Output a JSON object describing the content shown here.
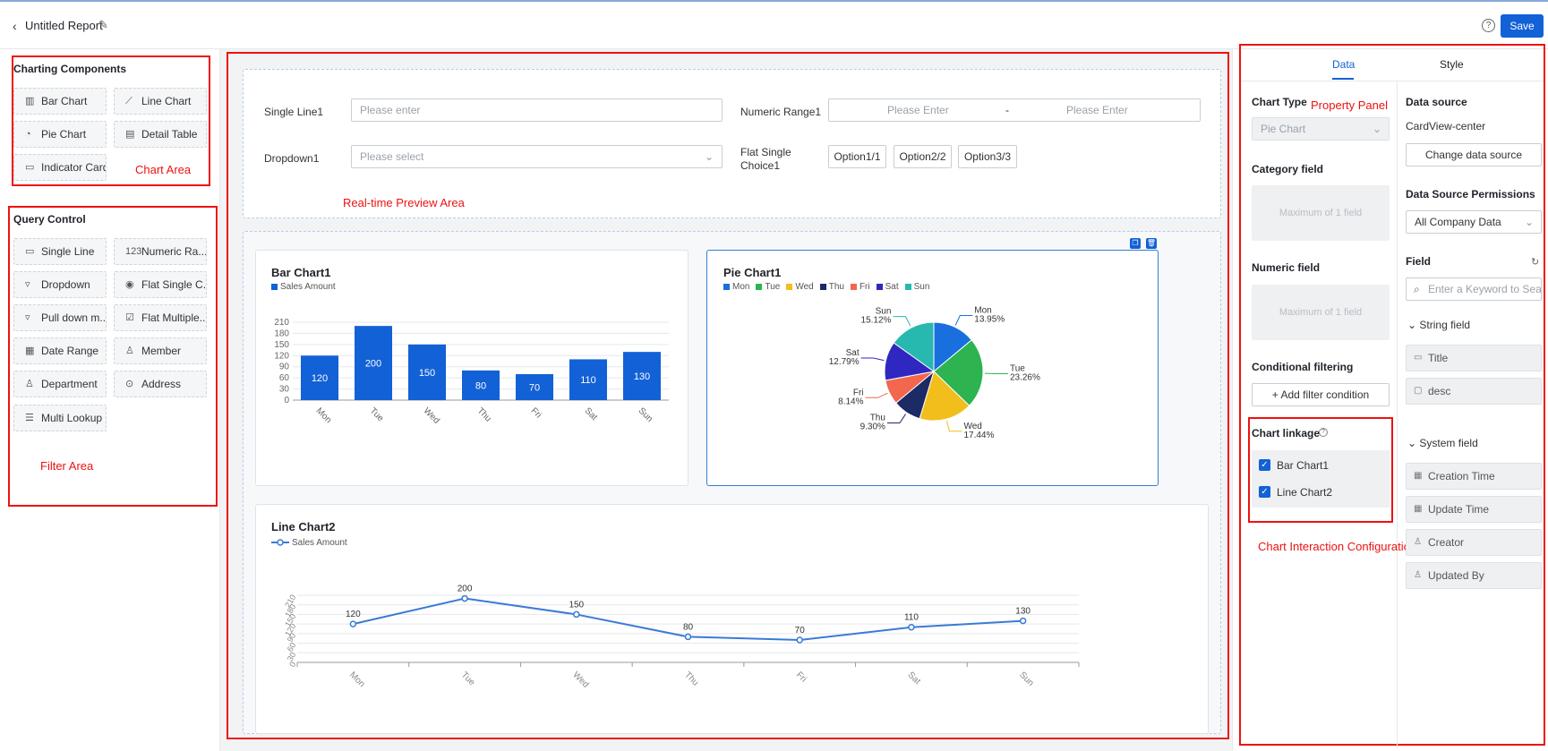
{
  "topbar": {
    "title": "Untitled Report",
    "save_label": "Save",
    "help": "?"
  },
  "annotations": {
    "chart_area": "Chart Area",
    "filter_area": "Filter Area",
    "preview_area": "Real-time Preview Area",
    "property_panel": "Property Panel",
    "interaction": "Chart Interaction Configuration"
  },
  "left": {
    "charting_title": "Charting Components",
    "charting": [
      {
        "label": "Bar Chart",
        "icon": "bar-chart-icon"
      },
      {
        "label": "Line Chart",
        "icon": "line-chart-icon"
      },
      {
        "label": "Pie Chart",
        "icon": "pie-chart-icon"
      },
      {
        "label": "Detail Table",
        "icon": "table-icon"
      },
      {
        "label": "Indicator Card",
        "icon": "indicator-card-icon"
      }
    ],
    "query_title": "Query Control",
    "query": [
      {
        "label": "Single Line",
        "icon": "single-line-icon"
      },
      {
        "label": "Numeric Ra...",
        "icon": "numeric-icon"
      },
      {
        "label": "Dropdown",
        "icon": "dropdown-icon"
      },
      {
        "label": "Flat Single C...",
        "icon": "radio-icon"
      },
      {
        "label": "Pull down m...",
        "icon": "pulldown-icon"
      },
      {
        "label": "Flat Multiple...",
        "icon": "checkbox-icon"
      },
      {
        "label": "Date Range",
        "icon": "calendar-icon"
      },
      {
        "label": "Member",
        "icon": "member-icon"
      },
      {
        "label": "Department",
        "icon": "department-icon"
      },
      {
        "label": "Address",
        "icon": "location-icon"
      },
      {
        "label": "Multi Lookup",
        "icon": "lookup-icon"
      }
    ]
  },
  "filters": {
    "single_line_label": "Single Line1",
    "single_line_placeholder": "Please enter",
    "numeric_label": "Numeric Range1",
    "numeric_from": "Please Enter",
    "numeric_sep": "-",
    "numeric_to": "Please Enter",
    "dropdown_label": "Dropdown1",
    "dropdown_placeholder": "Please select",
    "flat_label_1": "Flat Single",
    "flat_label_2": "Choice1",
    "options": [
      "Option1/1",
      "Option2/2",
      "Option3/3"
    ]
  },
  "chart_data": [
    {
      "type": "bar",
      "title": "Bar Chart1",
      "legend": "Sales Amount",
      "categories": [
        "Mon",
        "Tue",
        "Wed",
        "Thu",
        "Fri",
        "Sat",
        "Sun"
      ],
      "values": [
        120,
        200,
        150,
        80,
        70,
        110,
        130
      ],
      "yticks": [
        0,
        30,
        60,
        90,
        120,
        150,
        180,
        210
      ],
      "ylim": [
        0,
        210
      ],
      "color": "#1261d6"
    },
    {
      "type": "pie",
      "title": "Pie Chart1",
      "categories": [
        "Mon",
        "Tue",
        "Wed",
        "Thu",
        "Fri",
        "Sat",
        "Sun"
      ],
      "values": [
        13.95,
        23.26,
        17.44,
        9.3,
        8.14,
        12.79,
        15.12
      ],
      "labels": [
        "13.95%",
        "23.26%",
        "17.44%",
        "9.30%",
        "8.14%",
        "12.79%",
        "15.12%"
      ],
      "colors": [
        "#1a6fde",
        "#2db350",
        "#f2be1c",
        "#1c2a66",
        "#f2674e",
        "#2f28c0",
        "#27b8b0"
      ]
    },
    {
      "type": "line",
      "title": "Line Chart2",
      "legend": "Sales Amount",
      "categories": [
        "Mon",
        "Tue",
        "Wed",
        "Thu",
        "Fri",
        "Sat",
        "Sun"
      ],
      "values": [
        120,
        200,
        150,
        80,
        70,
        110,
        130
      ],
      "yticks": [
        0,
        30,
        60,
        90,
        120,
        150,
        180,
        210
      ],
      "ylim": [
        0,
        210
      ],
      "color": "#3a7bd5"
    }
  ],
  "right": {
    "tab_data": "Data",
    "tab_style": "Style",
    "chart_type_label": "Chart Type",
    "chart_type_value": "Pie Chart",
    "category_label": "Category field",
    "category_hint": "Maximum of 1 field",
    "numeric_label": "Numeric field",
    "numeric_hint": "Maximum of 1 field",
    "cond_label": "Conditional filtering",
    "cond_btn": "Add filter condition",
    "linkage_label": "Chart linkage",
    "linkage_items": [
      "Bar Chart1",
      "Line Chart2"
    ],
    "ds_label": "Data source",
    "ds_value": "CardView-center",
    "ds_btn": "Change data source",
    "perm_label": "Data Source Permissions",
    "perm_value": "All Company Data",
    "field_label": "Field",
    "field_search": "Enter a Keyword to Sea",
    "string_group": "String field",
    "string_fields": [
      "Title",
      "desc"
    ],
    "system_group": "System field",
    "system_fields": [
      "Creation Time",
      "Update Time",
      "Creator",
      "Updated By"
    ]
  }
}
